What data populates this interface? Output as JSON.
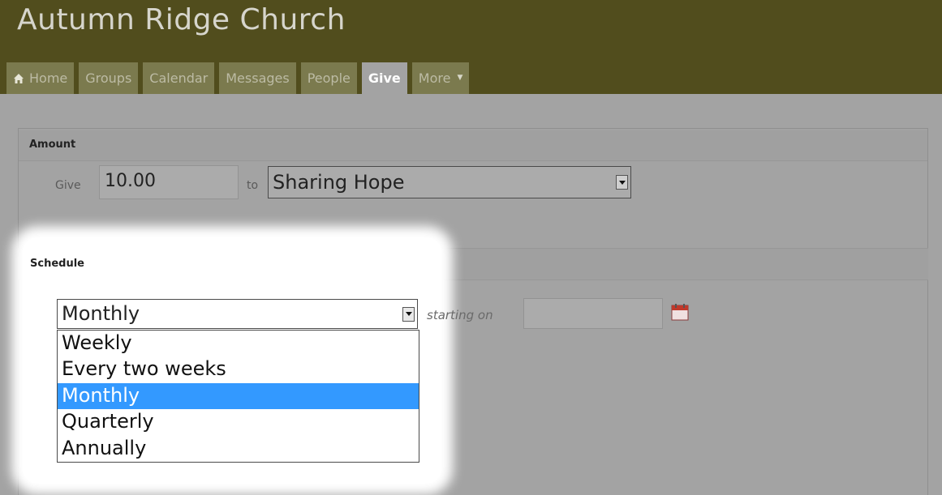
{
  "site": {
    "title": "Autumn Ridge Church"
  },
  "nav": {
    "tabs": [
      {
        "label": "Home",
        "icon": "home-icon"
      },
      {
        "label": "Groups"
      },
      {
        "label": "Calendar"
      },
      {
        "label": "Messages"
      },
      {
        "label": "People"
      },
      {
        "label": "Give",
        "active": true
      },
      {
        "label": "More",
        "icon": "caret-down-icon"
      }
    ],
    "more_caret": "▼"
  },
  "amount": {
    "section_title": "Amount",
    "give_label": "Give",
    "value": "10.00",
    "to_label": "to",
    "fund_selected": "Sharing Hope"
  },
  "schedule": {
    "section_title": "Schedule",
    "frequency_selected": "Monthly",
    "starting_label": "starting on",
    "start_date": "",
    "options": [
      "Weekly",
      "Every two weeks",
      "Monthly",
      "Quarterly",
      "Annually"
    ],
    "highlighted_option": "Monthly"
  },
  "colors": {
    "header_bg": "#514d1d",
    "tab_bg": "#7b7a4e",
    "page_bg": "#a3a3a3",
    "highlight": "#3399ff"
  }
}
